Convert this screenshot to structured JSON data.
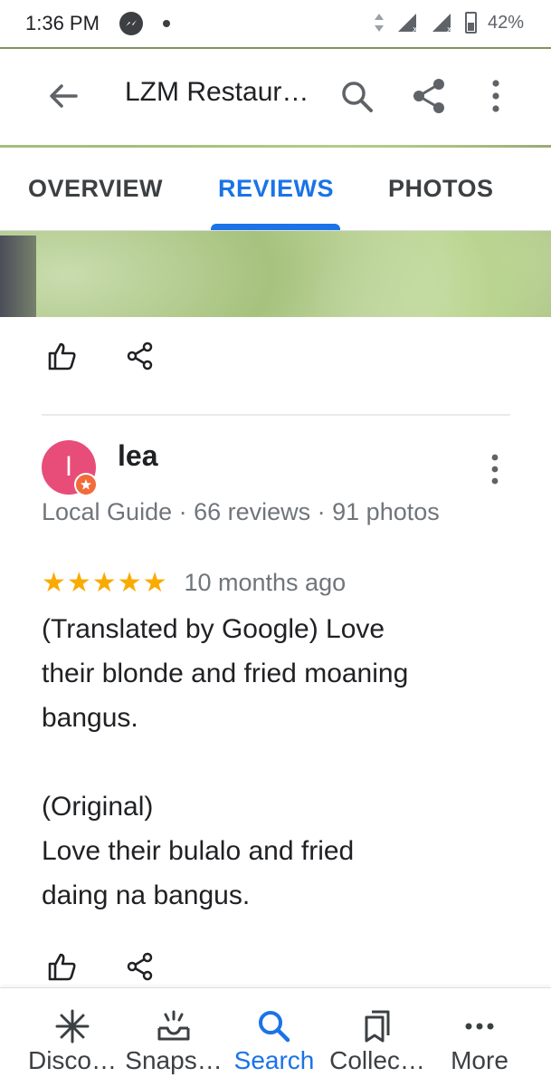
{
  "status_bar": {
    "time": "1:36 PM",
    "battery_percent": "42%",
    "icons": [
      "messenger-icon",
      "notification-dot",
      "data-arrows-icon",
      "signal-icon",
      "signal-icon",
      "battery-icon"
    ]
  },
  "app_bar": {
    "title": "LZM Restaur…",
    "icons": [
      "back-arrow-icon",
      "search-icon",
      "share-icon",
      "more-vert-icon"
    ]
  },
  "tabs": [
    {
      "label": "OVERVIEW",
      "active": false
    },
    {
      "label": "REVIEWS",
      "active": true
    },
    {
      "label": "PHOTOS",
      "active": false
    }
  ],
  "review": {
    "avatar_letter": "l",
    "reviewer_name": "lea",
    "reviewer_meta": "Local Guide · 66 reviews · 91 photos",
    "stars": "★★★★★",
    "rating": 5,
    "date": "10 months ago",
    "text_translated_lines": [
      "(Translated by Google) Love",
      "their blonde and fried moaning",
      "bangus."
    ],
    "text_original_label": "(Original)",
    "text_original_lines": [
      "Love their bulalo and fried",
      "daing na bangus."
    ]
  },
  "bottom_nav": [
    {
      "label": "Disco…",
      "icon": "asterisk-icon",
      "active": false
    },
    {
      "label": "Snaps…",
      "icon": "tray-icon",
      "active": false
    },
    {
      "label": "Search",
      "icon": "search-icon",
      "active": true
    },
    {
      "label": "Collec…",
      "icon": "bookmarks-icon",
      "active": false
    },
    {
      "label": "More",
      "icon": "more-horiz-icon",
      "active": false
    }
  ],
  "colors": {
    "accent": "#1a73e8",
    "star": "#f9ab00",
    "avatar": "#e84d7a",
    "badge": "#f26b3a"
  }
}
